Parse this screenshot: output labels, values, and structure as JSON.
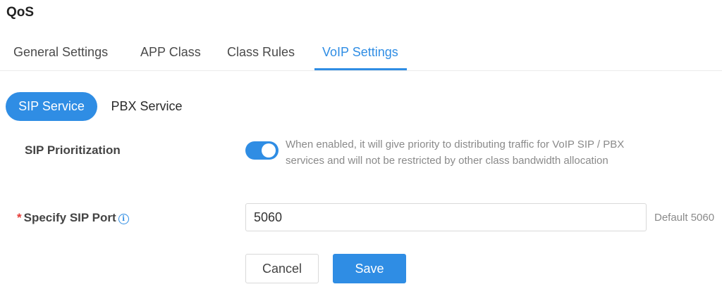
{
  "page": {
    "title": "QoS"
  },
  "tabs": [
    {
      "label": "General Settings",
      "active": false
    },
    {
      "label": "APP Class",
      "active": false
    },
    {
      "label": "Class Rules",
      "active": false
    },
    {
      "label": "VoIP Settings",
      "active": true
    }
  ],
  "service_switch": {
    "options": [
      {
        "label": "SIP Service",
        "active": true
      },
      {
        "label": "PBX Service",
        "active": false
      }
    ]
  },
  "form": {
    "sip_prioritization": {
      "label": "SIP Prioritization",
      "enabled": true,
      "help": "When enabled, it will give priority to distributing traffic for VoIP SIP / PBX services and will not be restricted by other class bandwidth allocation"
    },
    "sip_port": {
      "required_mark": "*",
      "label": "Specify SIP Port",
      "info_icon": "i",
      "value": "5060",
      "hint": "Default 5060"
    }
  },
  "actions": {
    "cancel_label": "Cancel",
    "save_label": "Save"
  },
  "colors": {
    "accent": "#2f8de4",
    "required": "#e53935",
    "muted_text": "#8a8a8a"
  }
}
